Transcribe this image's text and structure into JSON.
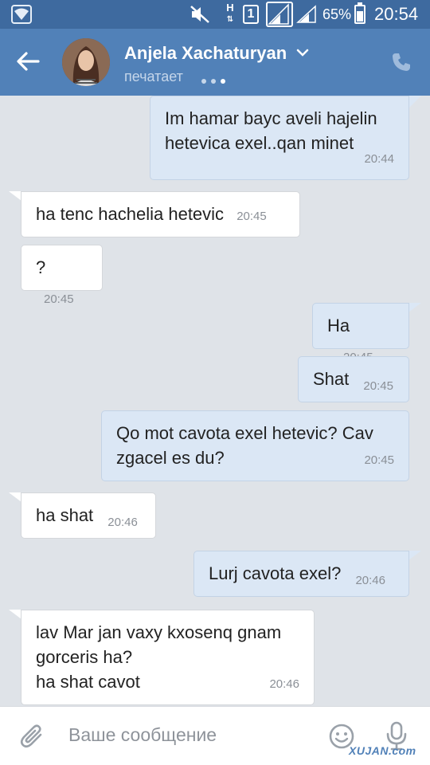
{
  "status_bar": {
    "network_label": "H",
    "sim_label": "1",
    "battery_percent": "65%",
    "battery_level": 0.65,
    "time": "20:54",
    "icons": [
      "wifi-icon",
      "mute-icon",
      "sim-icon",
      "signal-icon",
      "battery-icon"
    ]
  },
  "header": {
    "contact_name": "Anjela Xachaturyan",
    "status": "печатает",
    "icons": [
      "back-arrow-icon",
      "chevron-down-icon",
      "phone-icon"
    ]
  },
  "messages": [
    {
      "dir": "out",
      "text": "Im hamar bayc aveli hajelin\nhetevica exel..qan minet",
      "time": "20:44"
    },
    {
      "dir": "in",
      "text": "ha tenc hachelia hetevic",
      "time": "20:45"
    },
    {
      "dir": "in",
      "text": "?",
      "time": "20:45"
    },
    {
      "dir": "out",
      "text": "Ha",
      "time": "20:45"
    },
    {
      "dir": "out",
      "text": "Shat",
      "time": "20:45"
    },
    {
      "dir": "out",
      "text": "Qo mot cavota exel hetevic? Cav\nzgacel es du?",
      "time": "20:45"
    },
    {
      "dir": "in",
      "text": "ha shat",
      "time": "20:46"
    },
    {
      "dir": "out",
      "text": "Lurj cavota exel?",
      "time": "20:46"
    },
    {
      "dir": "in",
      "text": "lav Mar jan vaxy kxosenq gnam\ngorceris ha?\nha shat cavot",
      "time": "20:46"
    }
  ],
  "composer": {
    "placeholder": "Ваше сообщение",
    "icons": [
      "attach-icon",
      "emoji-icon",
      "mic-icon"
    ]
  },
  "watermark": "XUJAN.com",
  "colors": {
    "header": "#5181b8",
    "status_bar": "#3e6a9f",
    "chat_background": "#dfe3e8",
    "outgoing_bubble": "#dbe7f5",
    "incoming_bubble": "#ffffff"
  }
}
